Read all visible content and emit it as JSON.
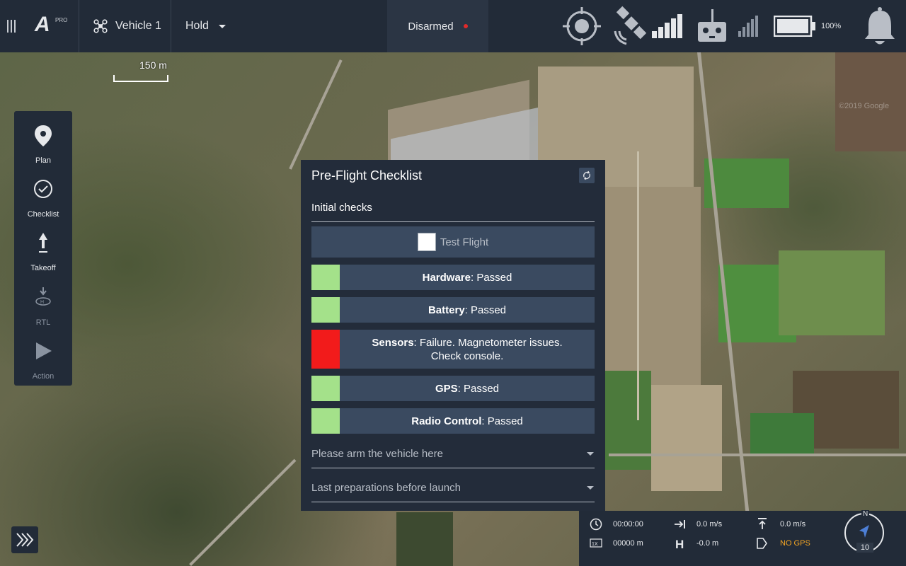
{
  "topbar": {
    "logo_letter": "A",
    "logo_badge": "PRO",
    "vehicle": "Vehicle 1",
    "mode": "Hold",
    "arm_status": "Disarmed",
    "battery_pct": "100%"
  },
  "map": {
    "scale_label": "150 m"
  },
  "toolbar": {
    "items": [
      {
        "label": "Plan",
        "enabled": true
      },
      {
        "label": "Checklist",
        "enabled": true
      },
      {
        "label": "Takeoff",
        "enabled": true
      },
      {
        "label": "RTL",
        "enabled": false
      },
      {
        "label": "Action",
        "enabled": false
      }
    ]
  },
  "checklist": {
    "title": "Pre-Flight Checklist",
    "sections": [
      "Initial checks",
      "Please arm the vehicle here",
      "Last preparations before launch"
    ],
    "test_flight_label": "Test Flight",
    "items": [
      {
        "name": "Hardware",
        "status": ": Passed",
        "color": "#a4e18a"
      },
      {
        "name": "Battery",
        "status": ": Passed",
        "color": "#a4e18a"
      },
      {
        "name": "Sensors",
        "status": ": Failure. Magnetometer issues. Check console.",
        "color": "#f21b1b"
      },
      {
        "name": "GPS",
        "status": ": Passed",
        "color": "#a4e18a"
      },
      {
        "name": "Radio Control",
        "status": ": Passed",
        "color": "#a4e18a"
      }
    ]
  },
  "telemetry": {
    "time": "00:00:00",
    "distance": "00000 m",
    "h_speed": "0.0 m/s",
    "height": "-0.0 m",
    "v_speed": "0.0 m/s",
    "gps": "NO GPS",
    "compass_north": "N",
    "heading": "10"
  }
}
